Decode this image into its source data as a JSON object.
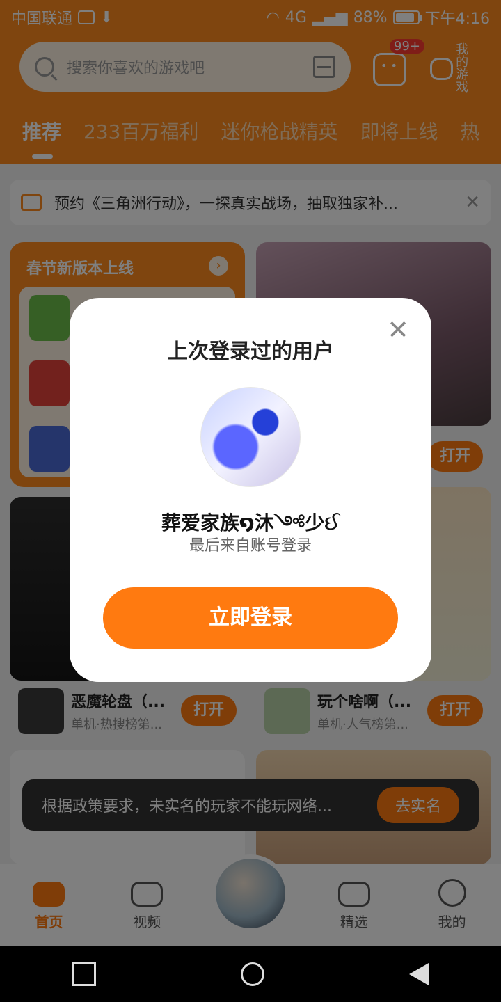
{
  "status_bar": {
    "carrier": "中国联通",
    "network": "4G",
    "battery": "88%",
    "battery_fraction": 0.88,
    "time": "下午4:16"
  },
  "header": {
    "search_placeholder": "搜索你喜欢的游戏吧",
    "message_badge": "99+",
    "my_games_label": "我的游戏",
    "tabs": [
      "推荐",
      "233百万福利",
      "迷你枪战精英",
      "即将上线",
      "热"
    ]
  },
  "notice": {
    "text": "预约《三角洲行动》，一探真实战场，抽取独家补..."
  },
  "promo_card": {
    "title": "春节新版本上线"
  },
  "game_cards": [
    {
      "title": "恶魔轮盘（...",
      "subtitle": "单机·热搜榜第...",
      "button": "打开"
    },
    {
      "title": "玩个啥啊（...",
      "subtitle": "单机·人气榜第...",
      "button": "打开"
    }
  ],
  "top_right_card": {
    "button": "打开"
  },
  "toast": {
    "text": "根据政策要求，未实名的玩家不能玩网络...",
    "action": "去实名"
  },
  "bottom_nav": [
    "首页",
    "视频",
    "精选",
    "我的"
  ],
  "modal": {
    "title": "上次登录过的用户",
    "username": "葬爱家族໑沐༺少ઈ",
    "subtitle": "最后来自账号登录",
    "login_button": "立即登录"
  },
  "colors": {
    "accent": "#ff7a10",
    "header": "#ff8a1e"
  }
}
